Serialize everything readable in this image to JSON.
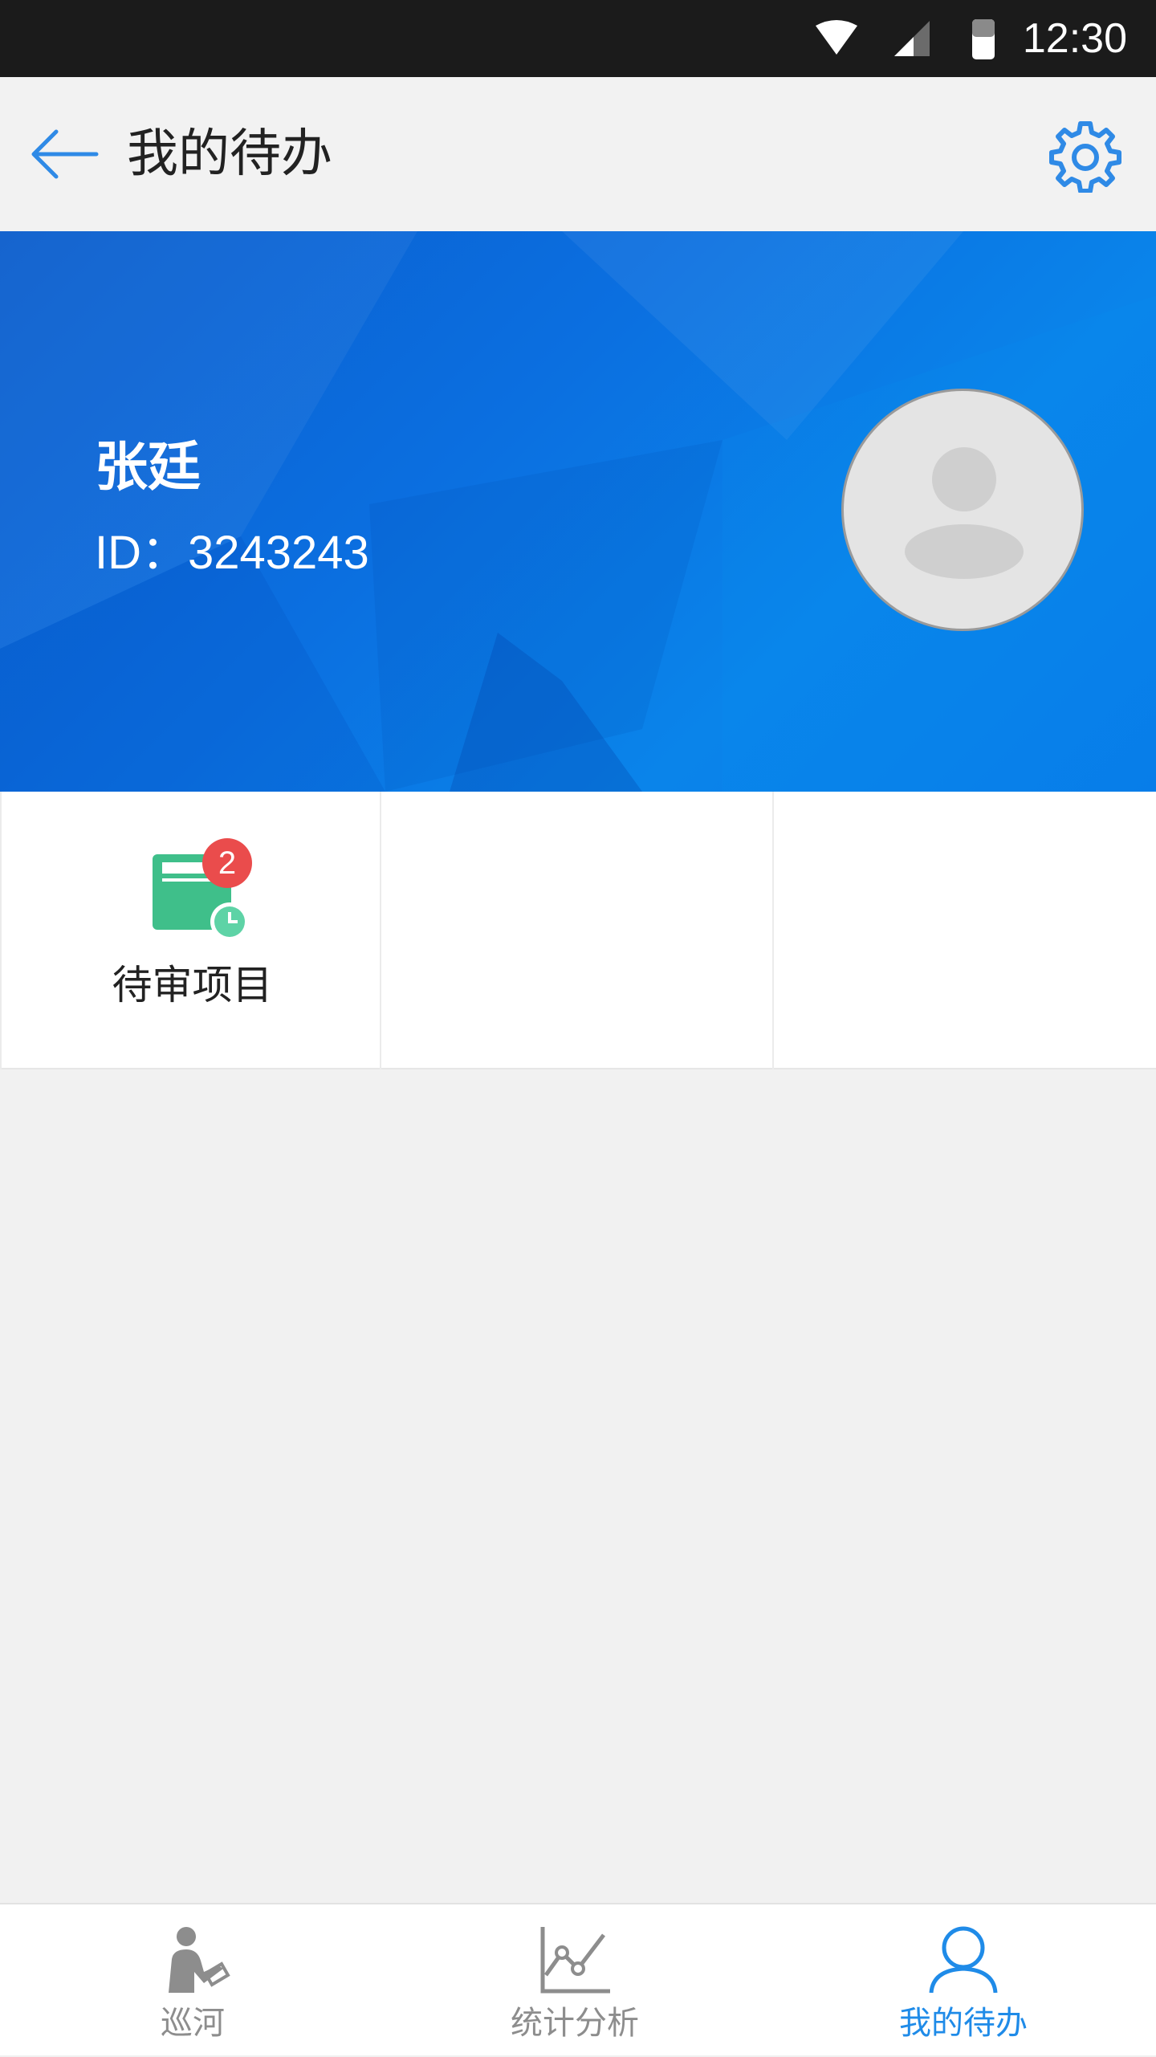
{
  "status_bar": {
    "time": "12:30"
  },
  "header": {
    "title": "我的待办"
  },
  "profile": {
    "name": "张廷",
    "id_text": "ID：3243243"
  },
  "tiles": [
    {
      "label": "待审项目",
      "badge": "2",
      "icon": "pending-review-icon"
    }
  ],
  "bottom_nav": {
    "items": [
      {
        "label": "巡河",
        "icon": "patrol-person-icon",
        "active": false
      },
      {
        "label": "统计分析",
        "icon": "chart-icon",
        "active": false
      },
      {
        "label": "我的待办",
        "icon": "user-icon",
        "active": true
      }
    ]
  },
  "colors": {
    "accent": "#1f8be8",
    "banner": "#0a6fe0",
    "badge": "#ea4c4c",
    "tile_icon": "#3fbf8a"
  }
}
